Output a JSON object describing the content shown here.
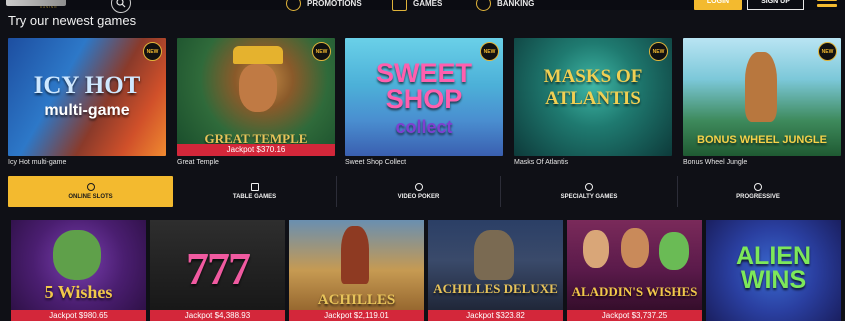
{
  "nav": {
    "logo_sub": "CASINO",
    "items": [
      {
        "label": "PROMOTIONS",
        "icon": "promotions-icon"
      },
      {
        "label": "GAMES",
        "icon": "games-icon"
      },
      {
        "label": "BANKING",
        "icon": "banking-icon"
      }
    ],
    "login": "LOGIN",
    "signup": "SIGN UP"
  },
  "section": {
    "title": "Try our newest games"
  },
  "new_games": [
    {
      "name": "Icy Hot multi-game",
      "logo": "ICY HOT",
      "logo2": "multi-game",
      "badge": "NEW",
      "jackpot": ""
    },
    {
      "name": "Great Temple",
      "logo": "GREAT TEMPLE",
      "logo2": "",
      "badge": "NEW",
      "jackpot": "Jackpot $370.16"
    },
    {
      "name": "Sweet Shop Collect",
      "logo": "SWEET SHOP",
      "logo2": "collect",
      "badge": "NEW",
      "jackpot": ""
    },
    {
      "name": "Masks Of Atlantis",
      "logo": "MASKS OF ATLANTIS",
      "logo2": "",
      "badge": "NEW",
      "jackpot": ""
    },
    {
      "name": "Bonus Wheel Jungle",
      "logo": "BONUS WHEEL JUNGLE",
      "logo2": "",
      "badge": "NEW",
      "jackpot": ""
    }
  ],
  "categories": [
    {
      "label": "ONLINE SLOTS",
      "icon": "cherries-icon",
      "active": true
    },
    {
      "label": "TABLE GAMES",
      "icon": "cards-icon",
      "active": false
    },
    {
      "label": "VIDEO POKER",
      "icon": "poker-chip-icon",
      "active": false
    },
    {
      "label": "SPECIALTY GAMES",
      "icon": "specialty-icon",
      "active": false
    },
    {
      "label": "PROGRESSIVE",
      "icon": "progressive-icon",
      "active": false
    }
  ],
  "slots": [
    {
      "logo": "5 Wishes",
      "jackpot": "Jackpot $980.65"
    },
    {
      "logo": "777",
      "jackpot": "Jackpot $4,388.93"
    },
    {
      "logo": "ACHILLES",
      "jackpot": "Jackpot $2,119.01"
    },
    {
      "logo": "ACHILLES DELUXE",
      "jackpot": "Jackpot $323.82"
    },
    {
      "logo": "ALADDIN'S WISHES",
      "jackpot": "Jackpot $3,737.25"
    },
    {
      "logo": "ALIEN WINS",
      "jackpot": ""
    }
  ],
  "colors": {
    "accent": "#f3ba2f",
    "jackpot": "#d3273a",
    "background": "#0f1016"
  }
}
